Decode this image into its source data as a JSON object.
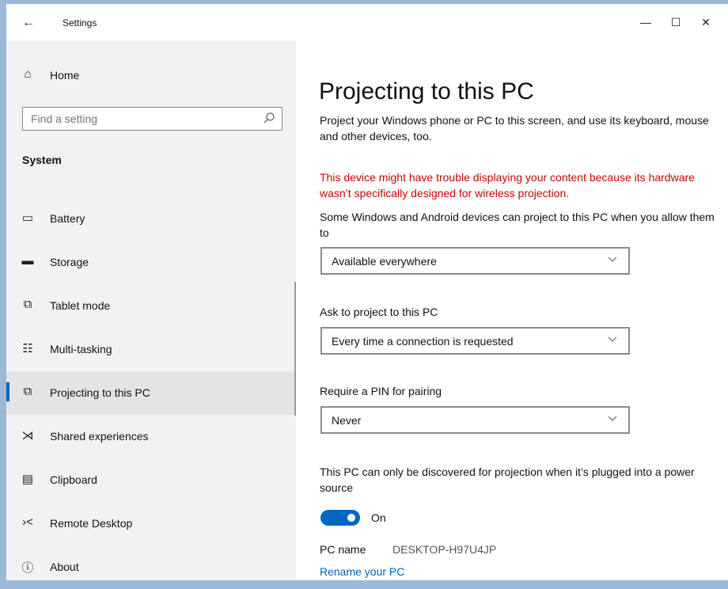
{
  "window": {
    "title": "Settings",
    "back_glyph": "←",
    "controls": {
      "minimize": "—",
      "maximize": "☐",
      "close": "✕"
    }
  },
  "sidebar": {
    "home": {
      "label": "Home",
      "icon": "home-icon"
    },
    "search": {
      "placeholder": "Find a setting",
      "icon": "search-icon"
    },
    "section": "System",
    "items": [
      {
        "label": "Battery",
        "icon": "battery-icon",
        "selected": false
      },
      {
        "label": "Storage",
        "icon": "storage-icon",
        "selected": false
      },
      {
        "label": "Tablet mode",
        "icon": "tablet-mode-icon",
        "selected": false
      },
      {
        "label": "Multi-tasking",
        "icon": "multitasking-icon",
        "selected": false
      },
      {
        "label": "Projecting to this PC",
        "icon": "projecting-icon",
        "selected": true
      },
      {
        "label": "Shared experiences",
        "icon": "shared-experiences-icon",
        "selected": false
      },
      {
        "label": "Clipboard",
        "icon": "clipboard-icon",
        "selected": false
      },
      {
        "label": "Remote Desktop",
        "icon": "remote-desktop-icon",
        "selected": false
      },
      {
        "label": "About",
        "icon": "info-icon",
        "selected": false
      }
    ]
  },
  "main": {
    "title": "Projecting to this PC",
    "intro": "Project your Windows phone or PC to this screen, and use its keyboard, mouse and other devices, too.",
    "warning": "This device might have trouble displaying your content because its hardware wasn’t specifically designed for wireless projection.",
    "availability_label": "Some Windows and Android devices can project to this PC when you allow them to",
    "availability_value": "Available everywhere",
    "ask_label": "Ask to project to this PC",
    "ask_value": "Every time a connection is requested",
    "pin_label": "Require a PIN for pairing",
    "pin_value": "Never",
    "power_label": "This PC can only be discovered for projection when it’s plugged into a power source",
    "power_toggle_state": "On",
    "pc_name_label": "PC name",
    "pc_name_value": "DESKTOP-H97U4JP",
    "rename_link": "Rename your PC"
  },
  "colors": {
    "accent": "#0067c0",
    "warning": "#c50500",
    "link": "#0063b1",
    "sidebar_bg": "#f2f2f2",
    "selected_bg": "#e4e4e4"
  }
}
